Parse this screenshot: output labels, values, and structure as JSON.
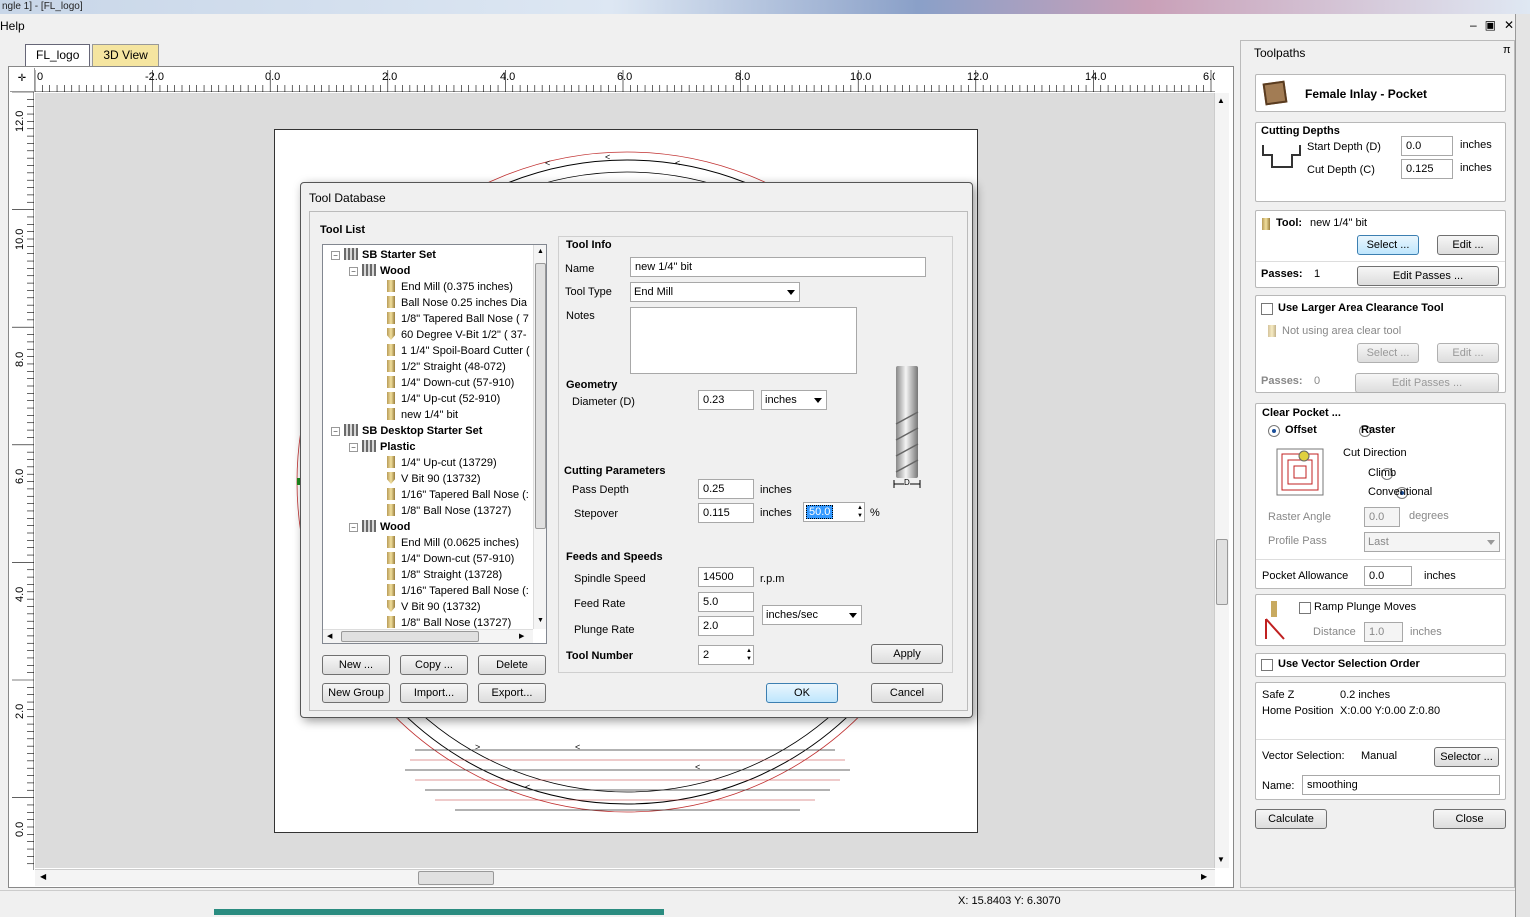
{
  "app": {
    "title_fragment": "ngle 1] - [FL_logo]",
    "menu_help": "Help"
  },
  "tabs": [
    {
      "label": "FL_logo"
    },
    {
      "label": "3D View"
    }
  ],
  "ruler": {
    "h_ticks": [
      "0",
      "-2.0",
      "0.0",
      "2.0",
      "4.0",
      "6.0",
      "8.0",
      "10.0",
      "12.0",
      "14.0",
      "6.0"
    ],
    "v_ticks": [
      "12.0",
      "10.0",
      "8.0",
      "6.0",
      "4.0",
      "2.0",
      "0.0"
    ]
  },
  "status": {
    "coords": "X: 15.8403 Y:  6.3070"
  },
  "toolpaths": {
    "title": "Toolpaths",
    "pin": "π",
    "toolpath_name": "Female Inlay - Pocket",
    "cutting_depths": {
      "title": "Cutting Depths",
      "start_label": "Start Depth (D)",
      "start_value": "0.0",
      "cut_label": "Cut Depth (C)",
      "cut_value": "0.125",
      "unit": "inches"
    },
    "tool": {
      "label": "Tool:",
      "value": "new 1/4\" bit",
      "select": "Select ...",
      "edit": "Edit ...",
      "passes_label": "Passes:",
      "passes_value": "1",
      "edit_passes": "Edit Passes ..."
    },
    "larger": {
      "label": "Use Larger Area Clearance Tool",
      "not_using": "Not using area clear tool",
      "select": "Select ...",
      "edit": "Edit ...",
      "passes_label": "Passes:",
      "passes_value": "0",
      "edit_passes": "Edit Passes ..."
    },
    "clear": {
      "title": "Clear Pocket ...",
      "offset": "Offset",
      "raster": "Raster",
      "cut_direction": "Cut Direction",
      "climb": "Climb",
      "conventional": "Conventional",
      "raster_angle_label": "Raster Angle",
      "raster_angle_value": "0.0",
      "degrees": "degrees",
      "profile_pass_label": "Profile Pass",
      "profile_pass_value": "Last",
      "allowance_label": "Pocket Allowance",
      "allowance_value": "0.0",
      "unit": "inches"
    },
    "ramp": {
      "label": "Ramp Plunge Moves",
      "distance_label": "Distance",
      "distance_value": "1.0",
      "unit": "inches"
    },
    "vector_order": {
      "label": "Use Vector Selection Order"
    },
    "info": {
      "safe_z_label": "Safe Z",
      "safe_z_value": "0.2 inches",
      "home_label": "Home Position",
      "home_value": "X:0.00 Y:0.00 Z:0.80",
      "vector_sel_label": "Vector Selection:",
      "vector_sel_value": "Manual",
      "selector": "Selector ...",
      "name_label": "Name:",
      "name_value": "smoothing"
    },
    "calculate": "Calculate",
    "close": "Close"
  },
  "dialog": {
    "title": "Tool Database",
    "tool_list_title": "Tool List",
    "tree": [
      {
        "level": 0,
        "type": "group",
        "label": "SB Starter Set"
      },
      {
        "level": 1,
        "type": "group",
        "label": "Wood"
      },
      {
        "level": 2,
        "type": "tool",
        "label": "End Mill (0.375 inches)"
      },
      {
        "level": 2,
        "type": "tool",
        "label": "Ball Nose 0.25 inches Dia"
      },
      {
        "level": 2,
        "type": "tool",
        "label": "1/8\" Tapered Ball Nose ( 7"
      },
      {
        "level": 2,
        "type": "vtool",
        "label": "60 Degree V-Bit 1/2\"  ( 37-"
      },
      {
        "level": 2,
        "type": "tool",
        "label": "1 1/4\" Spoil-Board Cutter ("
      },
      {
        "level": 2,
        "type": "tool",
        "label": "1/2\" Straight  (48-072)"
      },
      {
        "level": 2,
        "type": "tool",
        "label": "1/4\"  Down-cut (57-910)"
      },
      {
        "level": 2,
        "type": "tool",
        "label": "1/4\" Up-cut (52-910)"
      },
      {
        "level": 2,
        "type": "tool",
        "label": "new 1/4\" bit"
      },
      {
        "level": 0,
        "type": "group",
        "label": "SB Desktop Starter Set"
      },
      {
        "level": 1,
        "type": "group",
        "label": "Plastic"
      },
      {
        "level": 2,
        "type": "tool",
        "label": "1/4\" Up-cut (13729)"
      },
      {
        "level": 2,
        "type": "vtool",
        "label": "V Bit 90 (13732)"
      },
      {
        "level": 2,
        "type": "tool",
        "label": "1/16\" Tapered Ball Nose (:"
      },
      {
        "level": 2,
        "type": "tool",
        "label": "1/8\" Ball Nose (13727)"
      },
      {
        "level": 1,
        "type": "group",
        "label": "Wood"
      },
      {
        "level": 2,
        "type": "tool",
        "label": "End Mill (0.0625 inches)"
      },
      {
        "level": 2,
        "type": "tool",
        "label": "1/4\"  Down-cut (57-910)"
      },
      {
        "level": 2,
        "type": "tool",
        "label": "1/8\" Straight (13728)"
      },
      {
        "level": 2,
        "type": "tool",
        "label": "1/16\" Tapered Ball Nose (:"
      },
      {
        "level": 2,
        "type": "vtool",
        "label": "V Bit 90 (13732)"
      },
      {
        "level": 2,
        "type": "tool",
        "label": "1/8\" Ball Nose (13727)"
      }
    ],
    "buttons": {
      "new": "New ...",
      "copy": "Copy ...",
      "delete": "Delete",
      "new_group": "New Group",
      "import": "Import...",
      "export": "Export...",
      "apply": "Apply",
      "ok": "OK",
      "cancel": "Cancel"
    },
    "tool_info": {
      "title": "Tool Info",
      "name_label": "Name",
      "name_value": "new 1/4\" bit",
      "type_label": "Tool Type",
      "type_value": "End Mill",
      "notes_label": "Notes",
      "notes_value": ""
    },
    "geometry": {
      "title": "Geometry",
      "diameter_label": "Diameter (D)",
      "diameter_value": "0.23",
      "unit_value": "inches",
      "d_label": "D"
    },
    "cutting": {
      "title": "Cutting Parameters",
      "pass_label": "Pass Depth",
      "pass_value": "0.25",
      "stepover_label": "Stepover",
      "stepover_value": "0.115",
      "stepover_pct": "50.0",
      "unit": "inches",
      "pct_sign": "%"
    },
    "feeds": {
      "title": "Feeds and Speeds",
      "spindle_label": "Spindle Speed",
      "spindle_value": "14500",
      "rpm": "r.p.m",
      "feed_label": "Feed Rate",
      "feed_value": "5.0",
      "plunge_label": "Plunge Rate",
      "plunge_value": "2.0",
      "rate_unit": "inches/sec"
    },
    "tool_number": {
      "label": "Tool Number",
      "value": "2"
    }
  }
}
